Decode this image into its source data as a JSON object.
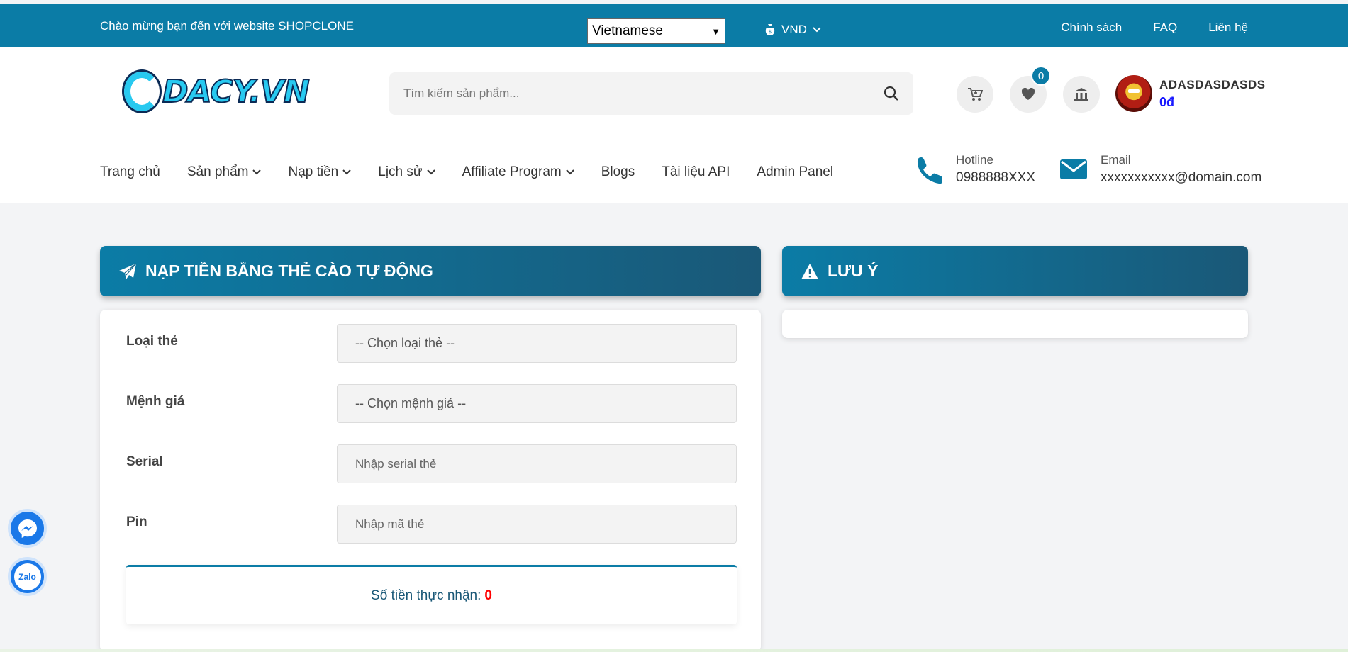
{
  "topbar": {
    "welcome": "Chào mừng bạn đến với website SHOPCLONE",
    "language": "Vietnamese",
    "currency": "VND",
    "links": [
      "Chính sách",
      "FAQ",
      "Liên hệ"
    ]
  },
  "header": {
    "logo_text": "DACY.VN",
    "search_placeholder": "Tìm kiếm sản phẩm...",
    "wishlist_count": "0",
    "user": {
      "name": "ADASDASDASDS",
      "balance": "0đ"
    }
  },
  "nav": {
    "items": [
      {
        "label": "Trang chủ",
        "dropdown": false
      },
      {
        "label": "Sản phẩm",
        "dropdown": true
      },
      {
        "label": "Nạp tiền",
        "dropdown": true
      },
      {
        "label": "Lịch sử",
        "dropdown": true
      },
      {
        "label": "Affiliate Program",
        "dropdown": true
      },
      {
        "label": "Blogs",
        "dropdown": false
      },
      {
        "label": "Tài liệu API",
        "dropdown": false
      },
      {
        "label": "Admin Panel",
        "dropdown": false
      }
    ],
    "hotline": {
      "label": "Hotline",
      "value": "0988888XXX"
    },
    "email": {
      "label": "Email",
      "value": "xxxxxxxxxxx@domain.com"
    }
  },
  "topup_card": {
    "title": "NẠP TIỀN BẰNG THẺ CÀO TỰ ĐỘNG",
    "fields": {
      "card_type": {
        "label": "Loại thẻ",
        "value": "-- Chọn loại thẻ --"
      },
      "denomination": {
        "label": "Mệnh giá",
        "value": "-- Chọn mệnh giá --"
      },
      "serial": {
        "label": "Serial",
        "placeholder": "Nhập serial thẻ"
      },
      "pin": {
        "label": "Pin",
        "placeholder": "Nhập mã thẻ"
      }
    },
    "receive_label": "Số tiền thực nhận:",
    "receive_amount": "0"
  },
  "note_card": {
    "title": "LƯU Ý"
  },
  "floating": {
    "zalo_label": "Zalo"
  },
  "colors": {
    "primary": "#0b7ca6",
    "dark": "#1a5877",
    "accent_red": "#ff0000",
    "balance_blue": "#1a1aff"
  }
}
